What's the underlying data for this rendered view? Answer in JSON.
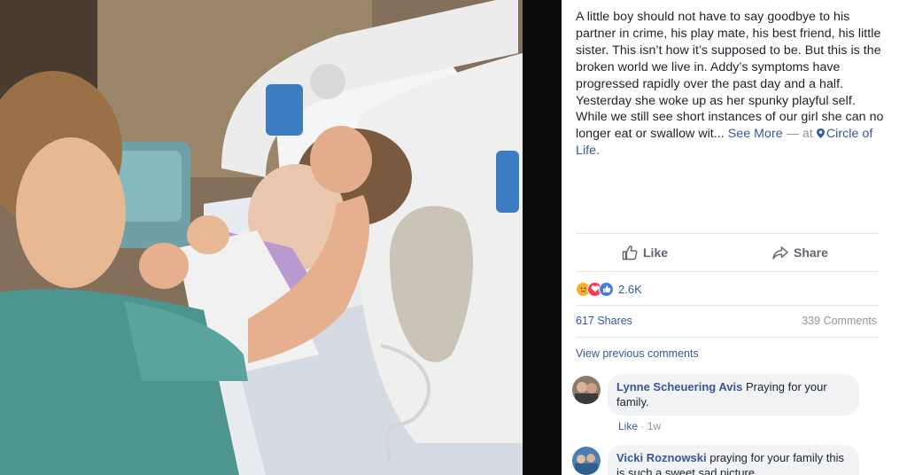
{
  "post": {
    "body": "A little boy should not have to say goodbye to his partner in crime, his play mate, his best friend, his little sister. This isn’t how it’s supposed to be. But this is the broken world we live in. Addy’s symptoms have progressed rapidly over the past day and a half. Yesterday she woke up as her spunky playful self. While we still see short instances of our girl she can no longer eat or swallow wit...",
    "see_more": "See More",
    "at_text": "— at",
    "location": "Circle of Life."
  },
  "actions": {
    "like_label": "Like",
    "share_label": "Share"
  },
  "stats": {
    "reactions_count": "2.6K",
    "reaction_icons": [
      "sad-face",
      "heart",
      "thumbs-up"
    ],
    "shares": "617 Shares",
    "comments": "339 Comments"
  },
  "comments_section": {
    "view_previous": "View previous comments",
    "items": [
      {
        "author": "Lynne Scheuering Avis",
        "text": "Praying for your family.",
        "like_label": "Like",
        "separator": "·",
        "time": "1w"
      },
      {
        "author": "Vicki Roznowski",
        "text": "praying for your family this is such a sweet sad picture"
      }
    ]
  },
  "colors": {
    "link": "#365899",
    "text": "#1d2129",
    "muted": "#90949c",
    "bubble": "#f2f3f5",
    "divider": "#0b0b0b"
  }
}
